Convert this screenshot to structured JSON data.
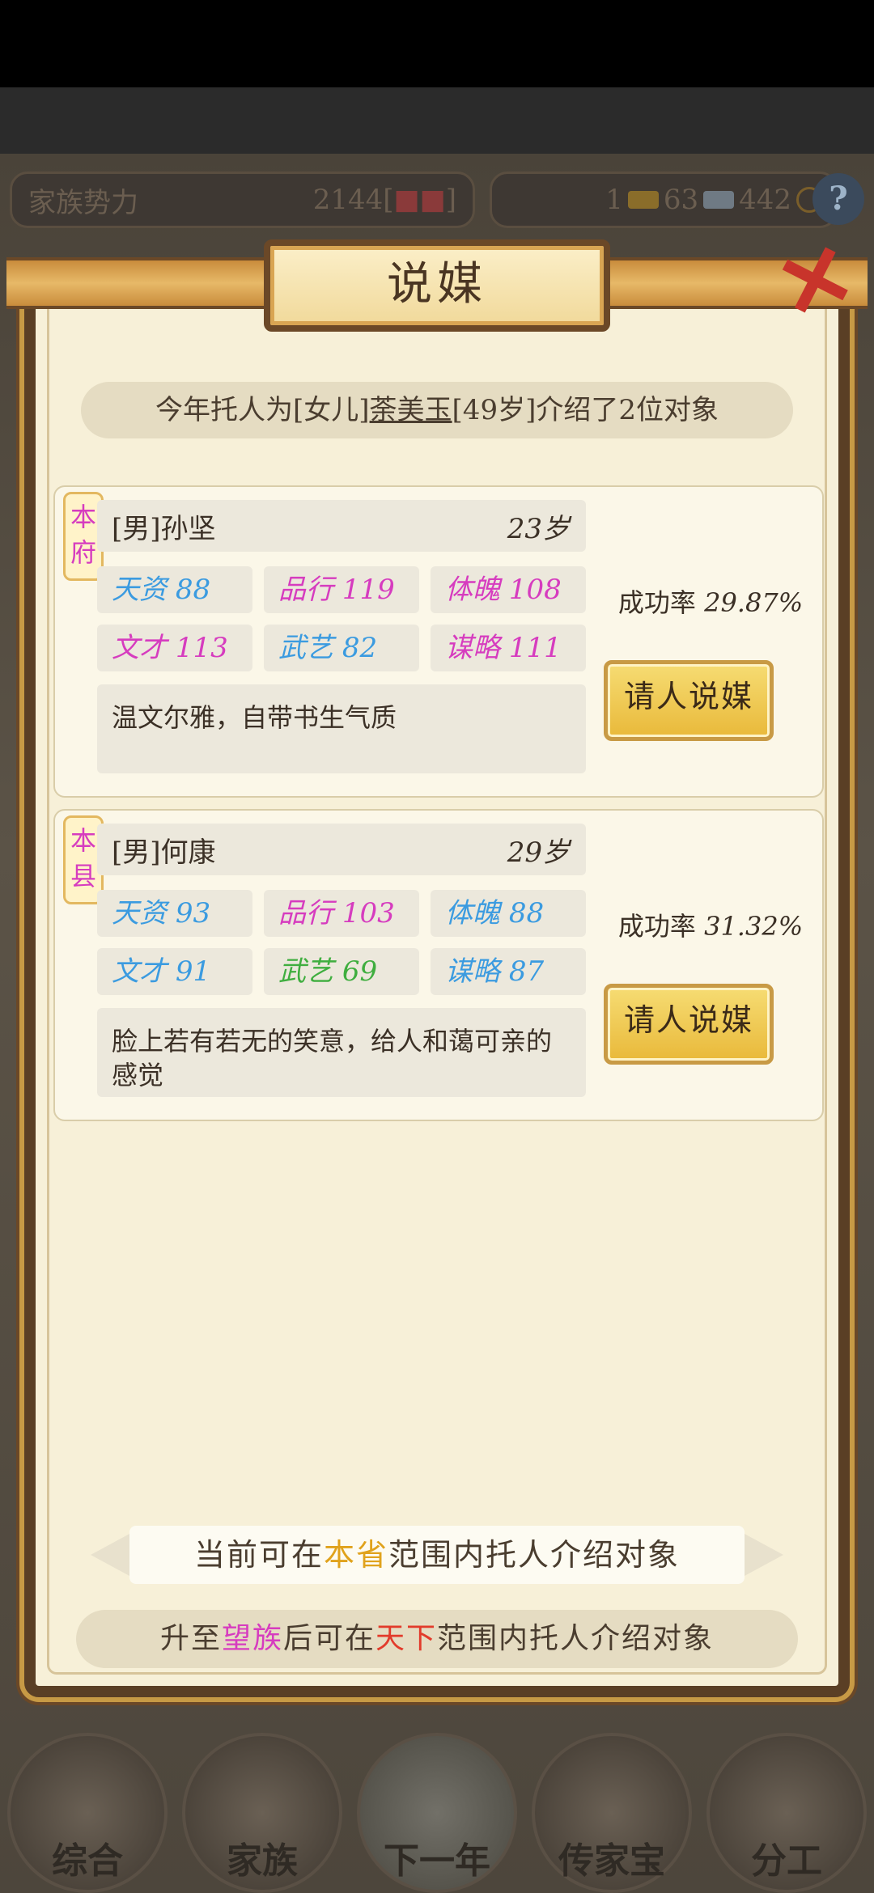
{
  "resources": {
    "family_power_label": "家族势力",
    "family_power_value": "2144[",
    "family_power_tail": "]",
    "gold": "1",
    "silver": "63",
    "coins": "442",
    "help_symbol": "?"
  },
  "dialog": {
    "title": "说媒",
    "close_symbol": "✕",
    "intro_prefix": "今年托人为[女儿]",
    "intro_name": "荼美玉",
    "intro_suffix": "[49岁]介绍了2位对象",
    "candidates": [
      {
        "tag": "本\n府",
        "name": "[男]孙坚",
        "age": "23岁",
        "stats": [
          {
            "label": "天资",
            "value": "88",
            "color": "#3b9be0"
          },
          {
            "label": "品行",
            "value": "119",
            "color": "#d63cbf"
          },
          {
            "label": "体魄",
            "value": "108",
            "color": "#d63cbf"
          },
          {
            "label": "文才",
            "value": "113",
            "color": "#d63cbf"
          },
          {
            "label": "武艺",
            "value": "82",
            "color": "#3b9be0"
          },
          {
            "label": "谋略",
            "value": "111",
            "color": "#d63cbf"
          }
        ],
        "description": "温文尔雅，自带书生气质",
        "rate_label": "成功率",
        "rate_value": "29.87%",
        "button": "请人说媒"
      },
      {
        "tag": "本\n县",
        "name": "[男]何康",
        "age": "29岁",
        "stats": [
          {
            "label": "天资",
            "value": "93",
            "color": "#3b9be0"
          },
          {
            "label": "品行",
            "value": "103",
            "color": "#d63cbf"
          },
          {
            "label": "体魄",
            "value": "88",
            "color": "#3b9be0"
          },
          {
            "label": "文才",
            "value": "91",
            "color": "#3b9be0"
          },
          {
            "label": "武艺",
            "value": "69",
            "color": "#3fae3f"
          },
          {
            "label": "谋略",
            "value": "87",
            "color": "#3b9be0"
          }
        ],
        "description": "脸上若有若无的笑意，给人和蔼可亲的感觉",
        "rate_label": "成功率",
        "rate_value": "31.32%",
        "button": "请人说媒"
      }
    ],
    "scope": {
      "prefix": "当前可在",
      "highlight": "本省",
      "highlight_color": "#e0a21c",
      "suffix": "范围内托人介绍对象"
    },
    "upgrade": {
      "p1": "升至",
      "h1": "望族",
      "h1_color": "#d63cbf",
      "p2": "后可在",
      "h2": "天下",
      "h2_color": "#e23b2b",
      "p3": "范围内托人介绍对象"
    }
  },
  "bottom_nav": [
    {
      "label": "综合"
    },
    {
      "label": "家族"
    },
    {
      "label": "下一年"
    },
    {
      "label": "传家宝"
    },
    {
      "label": "分工"
    }
  ]
}
